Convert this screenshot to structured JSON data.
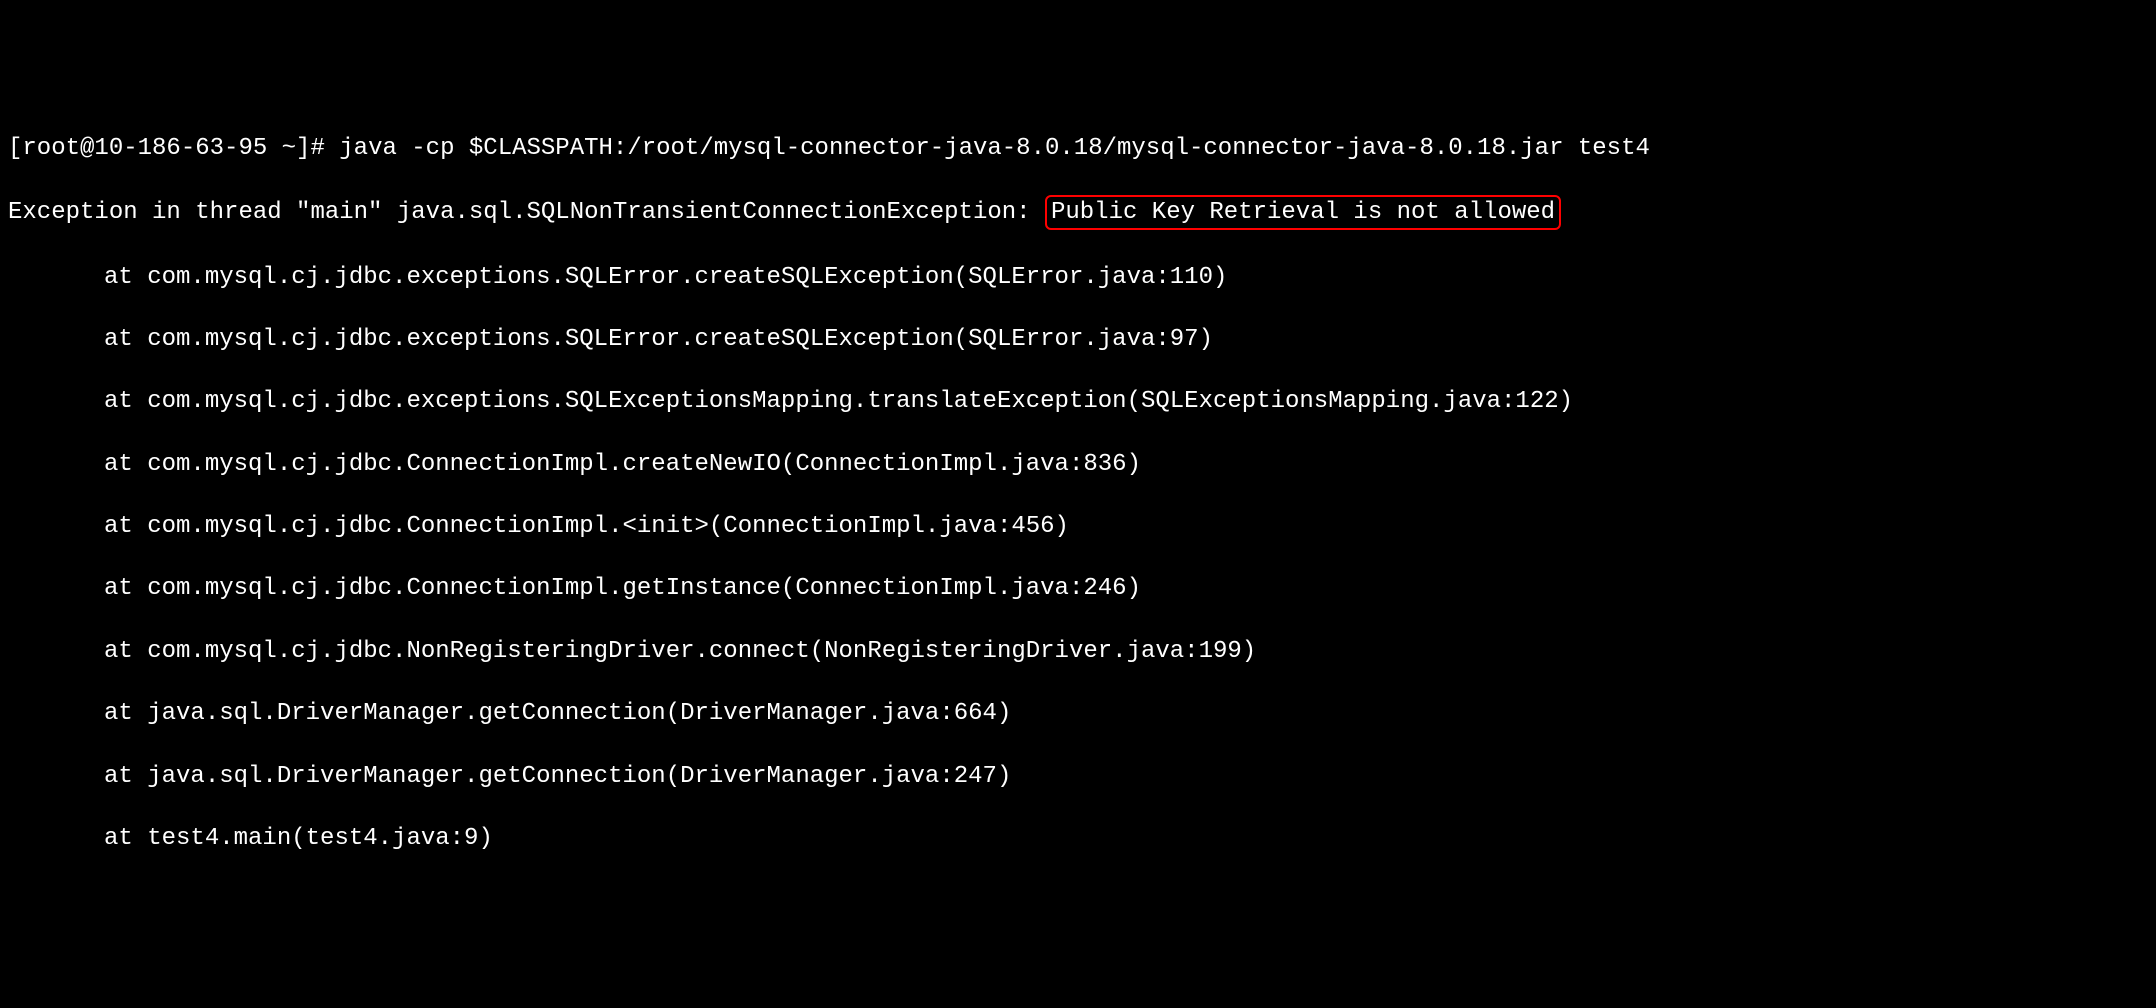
{
  "terminal": {
    "prompt": "[root@10-186-63-95 ~]# ",
    "command": "java -cp $CLASSPATH:/root/mysql-connector-java-8.0.18/mysql-connector-java-8.0.18.jar test4",
    "exception_prefix": "Exception in thread \"main\" java.sql.SQLNonTransientConnectionException: ",
    "exception_highlighted": "Public Key Retrieval is not allowed",
    "stack_trace": [
      "at com.mysql.cj.jdbc.exceptions.SQLError.createSQLException(SQLError.java:110)",
      "at com.mysql.cj.jdbc.exceptions.SQLError.createSQLException(SQLError.java:97)",
      "at com.mysql.cj.jdbc.exceptions.SQLExceptionsMapping.translateException(SQLExceptionsMapping.java:122)",
      "at com.mysql.cj.jdbc.ConnectionImpl.createNewIO(ConnectionImpl.java:836)",
      "at com.mysql.cj.jdbc.ConnectionImpl.<init>(ConnectionImpl.java:456)",
      "at com.mysql.cj.jdbc.ConnectionImpl.getInstance(ConnectionImpl.java:246)",
      "at com.mysql.cj.jdbc.NonRegisteringDriver.connect(NonRegisteringDriver.java:199)",
      "at java.sql.DriverManager.getConnection(DriverManager.java:664)",
      "at java.sql.DriverManager.getConnection(DriverManager.java:247)",
      "at test4.main(test4.java:9)"
    ]
  }
}
